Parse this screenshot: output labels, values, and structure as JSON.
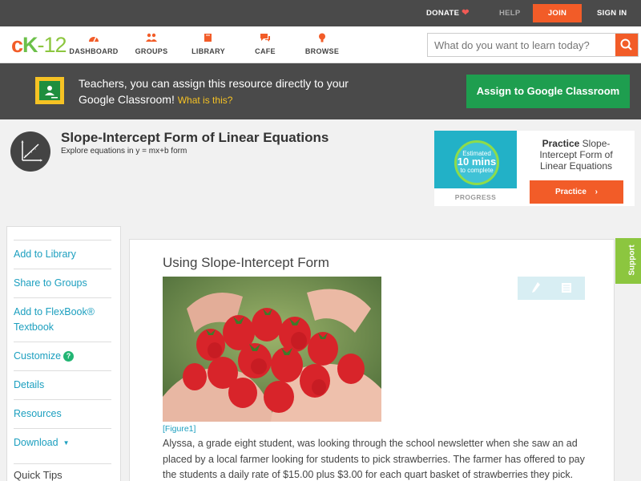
{
  "topbar": {
    "donate": "DONATE",
    "help": "HELP",
    "join": "JOIN",
    "signin": "SIGN IN"
  },
  "header": {
    "logo": {
      "c": "c",
      "k": "K",
      "n": "-12"
    },
    "nav": [
      {
        "label": "DASHBOARD",
        "icon": "dashboard-gauge-icon"
      },
      {
        "label": "GROUPS",
        "icon": "groups-people-icon"
      },
      {
        "label": "LIBRARY",
        "icon": "library-book-icon"
      },
      {
        "label": "CAFE",
        "icon": "cafe-chat-icon"
      },
      {
        "label": "BROWSE",
        "icon": "browse-lightbulb-icon"
      }
    ],
    "search_placeholder": "What do you want to learn today?"
  },
  "banner": {
    "text": "Teachers, you can assign this resource directly to your Google Classroom!",
    "what_link": "What is this?",
    "assign_button": "Assign to Google Classroom"
  },
  "concept": {
    "title": "Slope-Intercept Form of Linear Equations",
    "subtitle": "Explore equations in y = mx+b form"
  },
  "practice": {
    "estimate_top": "Estimated",
    "estimate_big": "10 mins",
    "estimate_bottom": "to complete",
    "progress_label": "PROGRESS",
    "title_bold": "Practice",
    "title_rest": "Slope-Intercept Form of Linear Equations",
    "button": "Practice"
  },
  "sidebar": {
    "items": [
      {
        "label": "Add to Library"
      },
      {
        "label": "Share to Groups"
      },
      {
        "label": "Add to FlexBook® Textbook"
      },
      {
        "label": "Customize"
      },
      {
        "label": "Details"
      },
      {
        "label": "Resources"
      },
      {
        "label": "Download"
      }
    ],
    "quick_tips": "Quick Tips"
  },
  "lesson": {
    "title": "Using Slope-Intercept Form",
    "figure_caption": "[Figure1]",
    "paragraph": "Alyssa, a grade eight student, was looking through the school newsletter when she saw an ad placed by a local farmer looking for students to pick strawberries. The farmer has offered to pay the students a daily rate of $15.00 plus $3.00 for each quart basket of strawberries they pick."
  },
  "support": "Support",
  "colors": {
    "brand_orange": "#f25c28",
    "brand_green": "#8cc63f",
    "link_blue": "#1c9fbf",
    "classroom_green": "#1e9e4f"
  }
}
